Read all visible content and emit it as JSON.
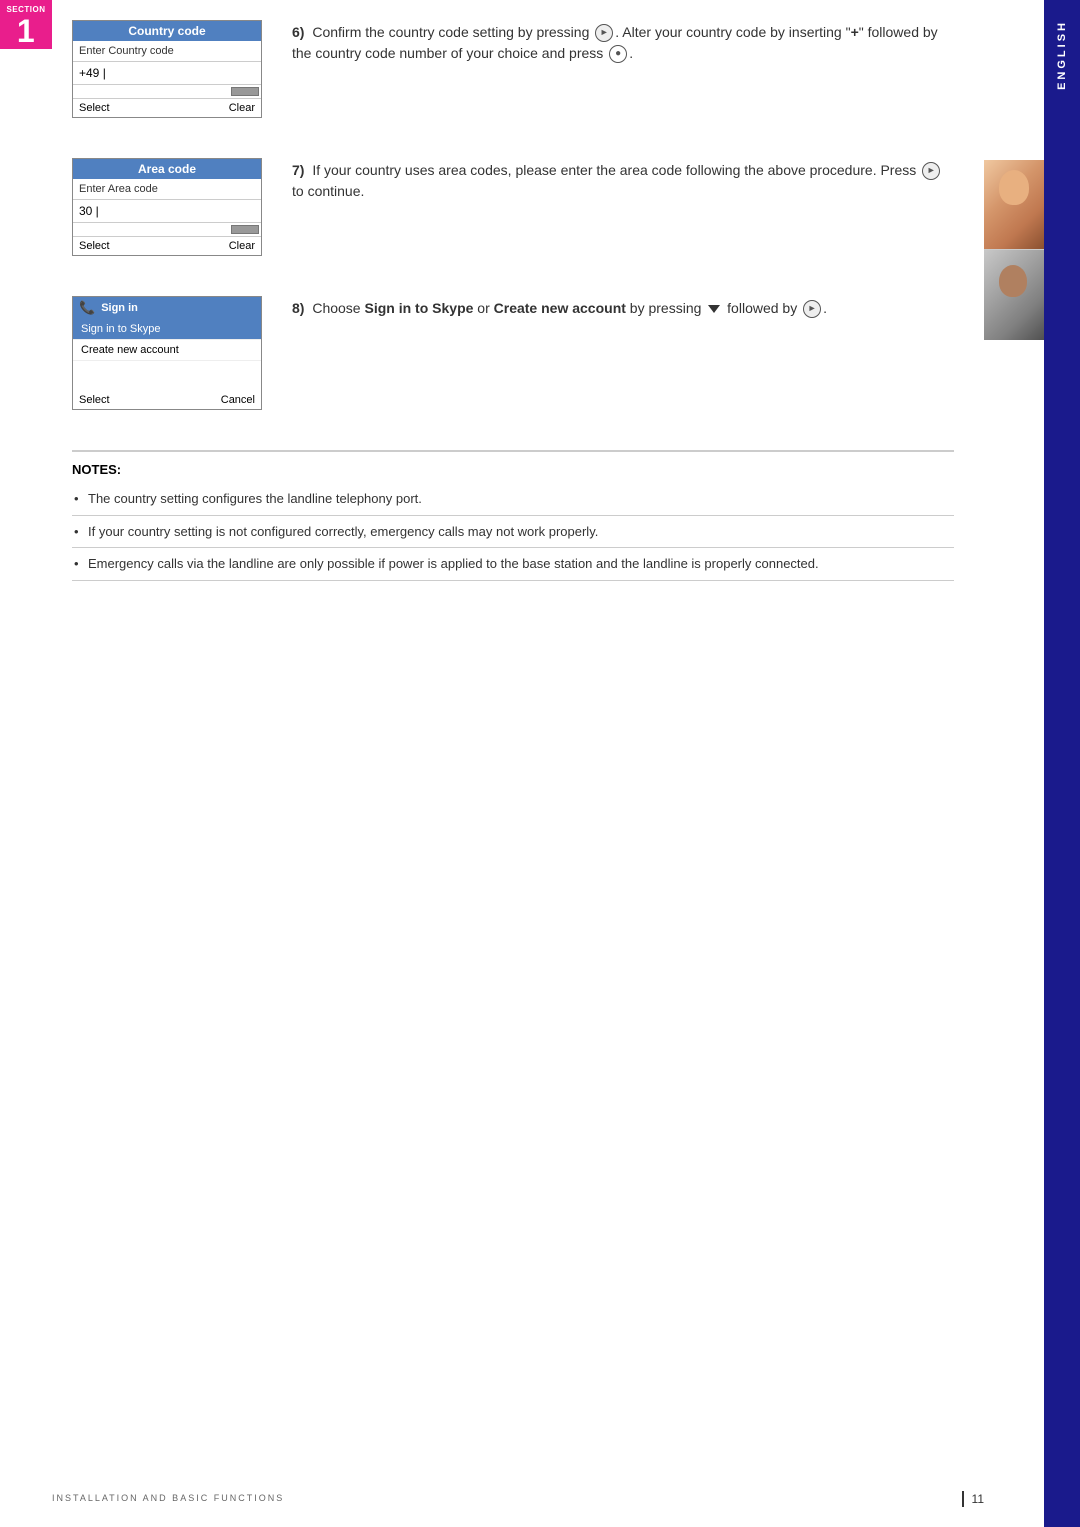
{
  "section": {
    "label": "SECTION",
    "number": "1"
  },
  "sidebar": {
    "vertical_text": "ENGLISH"
  },
  "steps": [
    {
      "number": "6)",
      "screen": {
        "title": "Country code",
        "subtitle": "Enter Country code",
        "input_value": "+49 |",
        "select_btn": "Select",
        "clear_btn": "Clear"
      },
      "text": "Confirm the country code setting by pressing ⓓ. Alter your country code by inserting “+” followed by the country code number of your choice and press ●."
    },
    {
      "number": "7)",
      "screen": {
        "title": "Area code",
        "subtitle": "Enter Area code",
        "input_value": "30 |",
        "select_btn": "Select",
        "clear_btn": "Clear"
      },
      "text": "If your country uses area codes, please enter the area code following the above procedure. Press ⓓ to continue."
    },
    {
      "number": "8)",
      "screen": {
        "title": "Sign in",
        "menu_items": [
          "Sign in to Skype",
          "Create new account"
        ],
        "selected_index": 0,
        "select_btn": "Select",
        "cancel_btn": "Cancel"
      },
      "text": "Choose Sign in to Skype or Create new account by pressing ▼ followed by ⓓ."
    }
  ],
  "notes": {
    "title": "NOTES:",
    "items": [
      "The country setting configures the landline telephony port.",
      "If your country setting is not configured correctly, emergency calls may not work properly.",
      "Emergency calls via the landline are only possible if power is applied to the base station and the landline is properly connected."
    ]
  },
  "footer": {
    "left_text": "INSTALLATION AND BASIC FUNCTIONS",
    "page_number": "11"
  }
}
